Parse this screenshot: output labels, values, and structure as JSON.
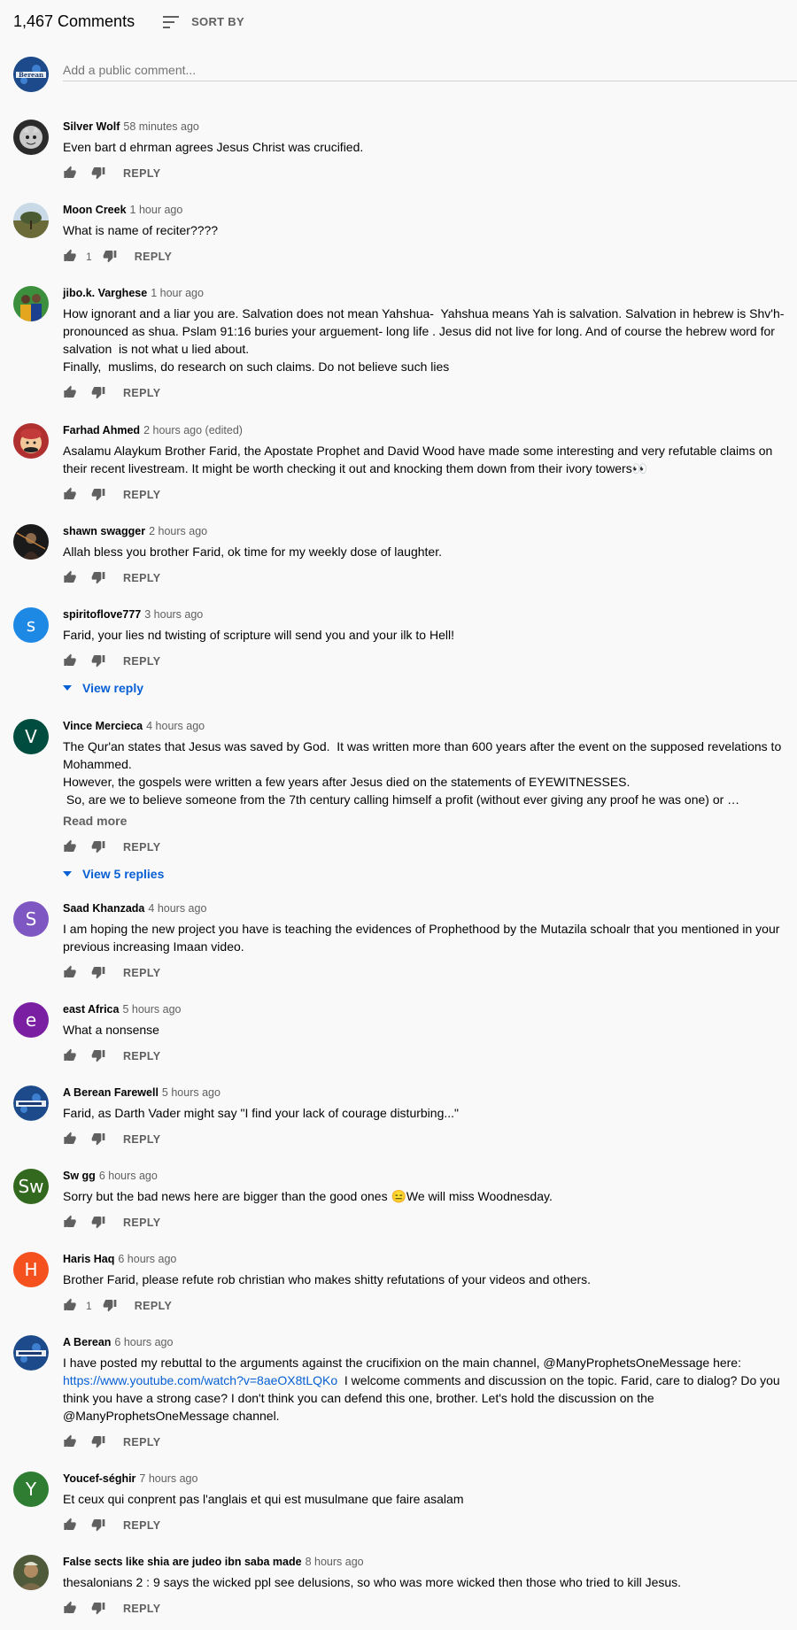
{
  "header": {
    "count": "1,467 Comments",
    "sort_label": "SORT BY"
  },
  "add_comment": {
    "placeholder": "Add a public comment...",
    "avatar_text": "Berean"
  },
  "reply_label": "REPLY",
  "comments": [
    {
      "author": "Silver Wolf",
      "time": "58 minutes ago",
      "text": "Even bart d ehrman agrees Jesus Christ was crucified.",
      "likes": ""
    },
    {
      "author": "Moon Creek",
      "time": "1 hour ago",
      "text": "What is name of reciter????",
      "likes": "1"
    },
    {
      "author": "jibo.k. Varghese",
      "time": "1 hour ago",
      "text": "How ignorant and a liar you are. Salvation does not mean Yahshua-  Yahshua means Yah is salvation. Salvation in hebrew is Shv'h- pronounced as shua. Pslam 91:16 buries your arguement- long life . Jesus did not live for long. And of course the hebrew word for salvation  is not what u lied about.\nFinally,  muslims, do research on such claims. Do not believe such lies",
      "likes": ""
    },
    {
      "author": "Farhad Ahmed",
      "time": "2 hours ago (edited)",
      "text": "Asalamu Alaykum Brother Farid, the Apostate Prophet and David Wood have made some interesting and very refutable claims on their recent livestream. It might be worth checking it out and knocking them down from their ivory towers👀",
      "likes": ""
    },
    {
      "author": "shawn swagger",
      "time": "2 hours ago",
      "text": "Allah bless you brother Farid, ok time for my weekly dose of laughter.",
      "likes": ""
    },
    {
      "author": "spiritoflove777",
      "time": "3 hours ago",
      "text": "Farid, your lies nd twisting of scripture will send you and your ilk to Hell!",
      "likes": "",
      "view_replies": "View reply",
      "avatar_letter": "s",
      "avatar_color": "#1e88e5"
    },
    {
      "author": "Vince Mercieca",
      "time": "4 hours ago",
      "text": "The Qur'an states that Jesus was saved by God.  It was written more than 600 years after the event on the supposed revelations to Mohammed.\nHowever, the gospels were written a few years after Jesus died on the statements of EYEWITNESSES.\n So, are we to believe someone from the 7th century calling himself a profit (without ever giving any proof he was one) or …",
      "likes": "",
      "read_more": "Read more",
      "view_replies": "View 5 replies",
      "avatar_letter": "V",
      "avatar_color": "#004d40"
    },
    {
      "author": "Saad Khanzada",
      "time": "4 hours ago",
      "text": "I am hoping the new project you have is teaching the evidences of Prophethood by the Mutazila schoalr that you mentioned in your previous increasing Imaan video.",
      "likes": "",
      "avatar_letter": "S",
      "avatar_color": "#7e57c2"
    },
    {
      "author": "east Africa",
      "time": "5 hours ago",
      "text": "What a nonsense",
      "likes": "",
      "avatar_letter": "e",
      "avatar_color": "#7b1fa2"
    },
    {
      "author": "A Berean Farewell",
      "time": "5 hours ago",
      "text": "Farid, as Darth Vader might say \"I find your lack of courage disturbing...\"",
      "likes": ""
    },
    {
      "author": "Sw gg",
      "time": "6 hours ago",
      "text": "Sorry but the bad news here are bigger than the good ones 😑We will miss Woodnesday.",
      "likes": "",
      "avatar_letter": "Sw",
      "avatar_color": "#33691e"
    },
    {
      "author": "Haris Haq",
      "time": "6 hours ago",
      "text": "Brother Farid, please refute rob christian who makes shitty refutations of your videos and others.",
      "likes": "1",
      "avatar_letter": "H",
      "avatar_color": "#f4511e"
    },
    {
      "author": "A Berean",
      "time": "6 hours ago",
      "text_before": "I have posted my rebuttal to the arguments against the crucifixion on the main channel, @ManyProphetsOneMessage here: ",
      "link": "https://www.youtube.com/watch?v=8aeOX8tLQKo",
      "text_after": "  I welcome comments and discussion on the topic. Farid, care to dialog? Do you think you have a strong case? I don't think you can defend this one, brother. Let's hold the discussion on the @ManyProphetsOneMessage channel.",
      "likes": ""
    },
    {
      "author": "Youcef-séghir",
      "time": "7 hours ago",
      "text": "Et ceux qui conprent pas l'anglais et qui est musulmane que faire asalam",
      "likes": "",
      "avatar_letter": "Y",
      "avatar_color": "#2e7d32"
    },
    {
      "author": "False sects like shia are judeo ibn saba made",
      "time": "8 hours ago",
      "text": "thesalonians 2 : 9 says the wicked ppl see delusions, so who was more wicked then those who tried to kill Jesus.",
      "likes": ""
    }
  ]
}
